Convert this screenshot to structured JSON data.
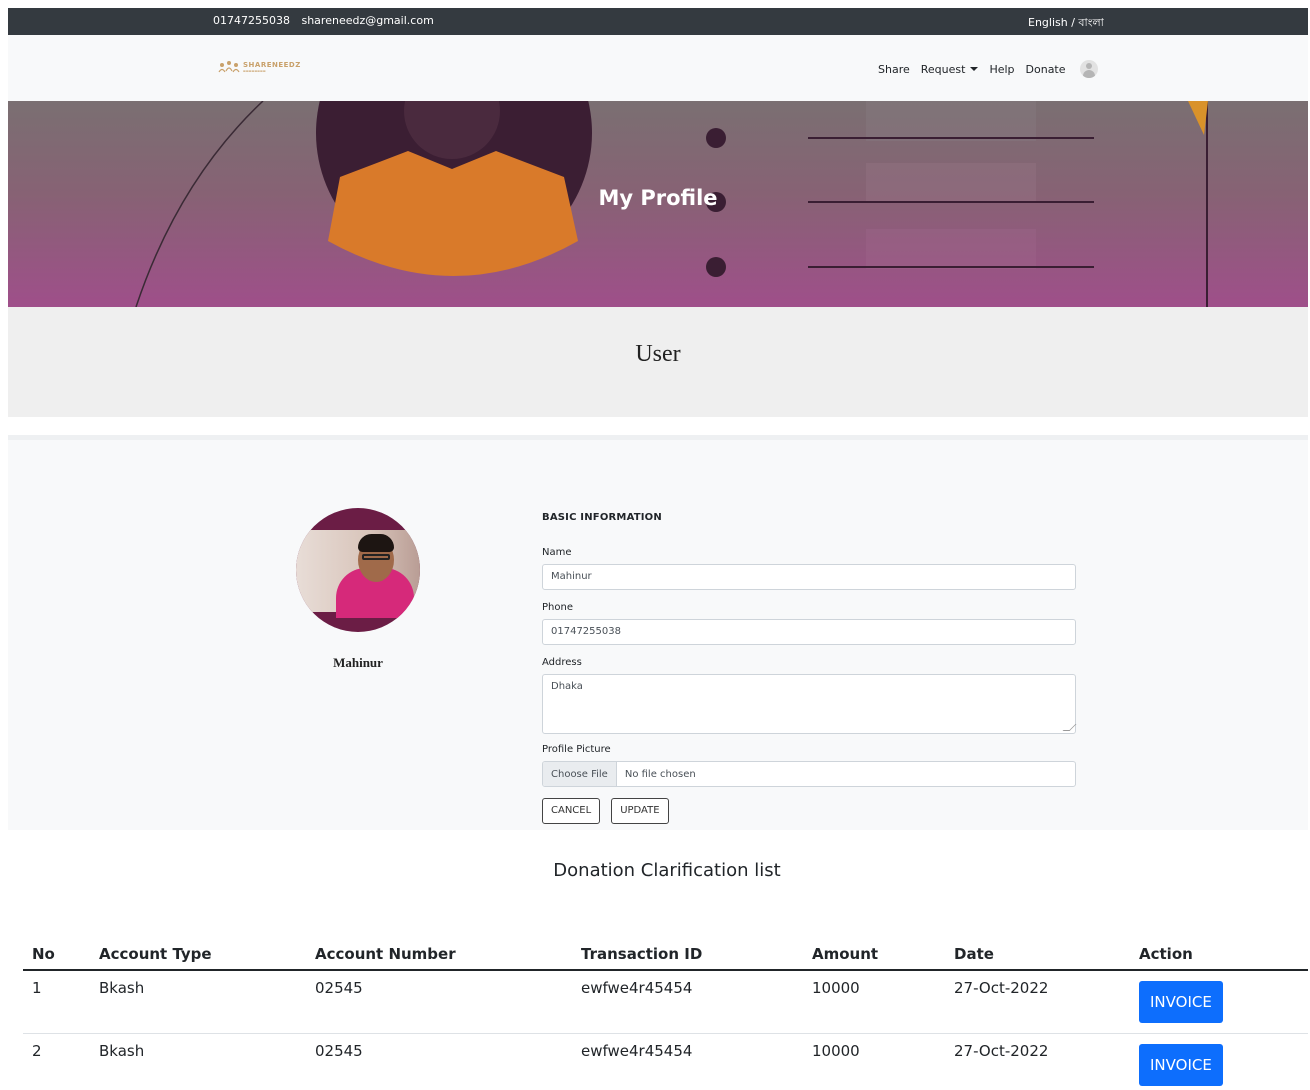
{
  "topbar": {
    "phone": "01747255038",
    "email": "shareneedz@gmail.com",
    "language": "English / বাংলা"
  },
  "nav": {
    "brand": "SHARENEEDZ",
    "links": {
      "share": "Share",
      "request": "Request",
      "help": "Help",
      "donate": "Donate"
    }
  },
  "banner": {
    "title": "My Profile"
  },
  "role": "User",
  "profile": {
    "name": "Mahinur",
    "section_title": "BASIC INFORMATION",
    "fields": {
      "name_label": "Name",
      "name_value": "Mahinur",
      "phone_label": "Phone",
      "phone_value": "01747255038",
      "address_label": "Address",
      "address_value": "Dhaka",
      "picture_label": "Profile Picture",
      "choose_file": "Choose File",
      "file_status": "No file chosen"
    },
    "buttons": {
      "cancel": "CANCEL",
      "update": "UPDATE"
    }
  },
  "donations": {
    "title": "Donation Clarification list",
    "headers": [
      "No",
      "Account Type",
      "Account Number",
      "Transaction ID",
      "Amount",
      "Date",
      "Action"
    ],
    "rows": [
      {
        "no": "1",
        "type": "Bkash",
        "number": "02545",
        "txn": "ewfwe4r45454",
        "amount": "10000",
        "date": "27-Oct-2022",
        "action": "INVOICE"
      },
      {
        "no": "2",
        "type": "Bkash",
        "number": "02545",
        "txn": "ewfwe4r45454",
        "amount": "10000",
        "date": "27-Oct-2022",
        "action": "INVOICE"
      }
    ]
  },
  "colors": {
    "topbar": "#343a40",
    "accent_button": "#0d6efd",
    "banner_bottom": "#9f4f8a"
  }
}
